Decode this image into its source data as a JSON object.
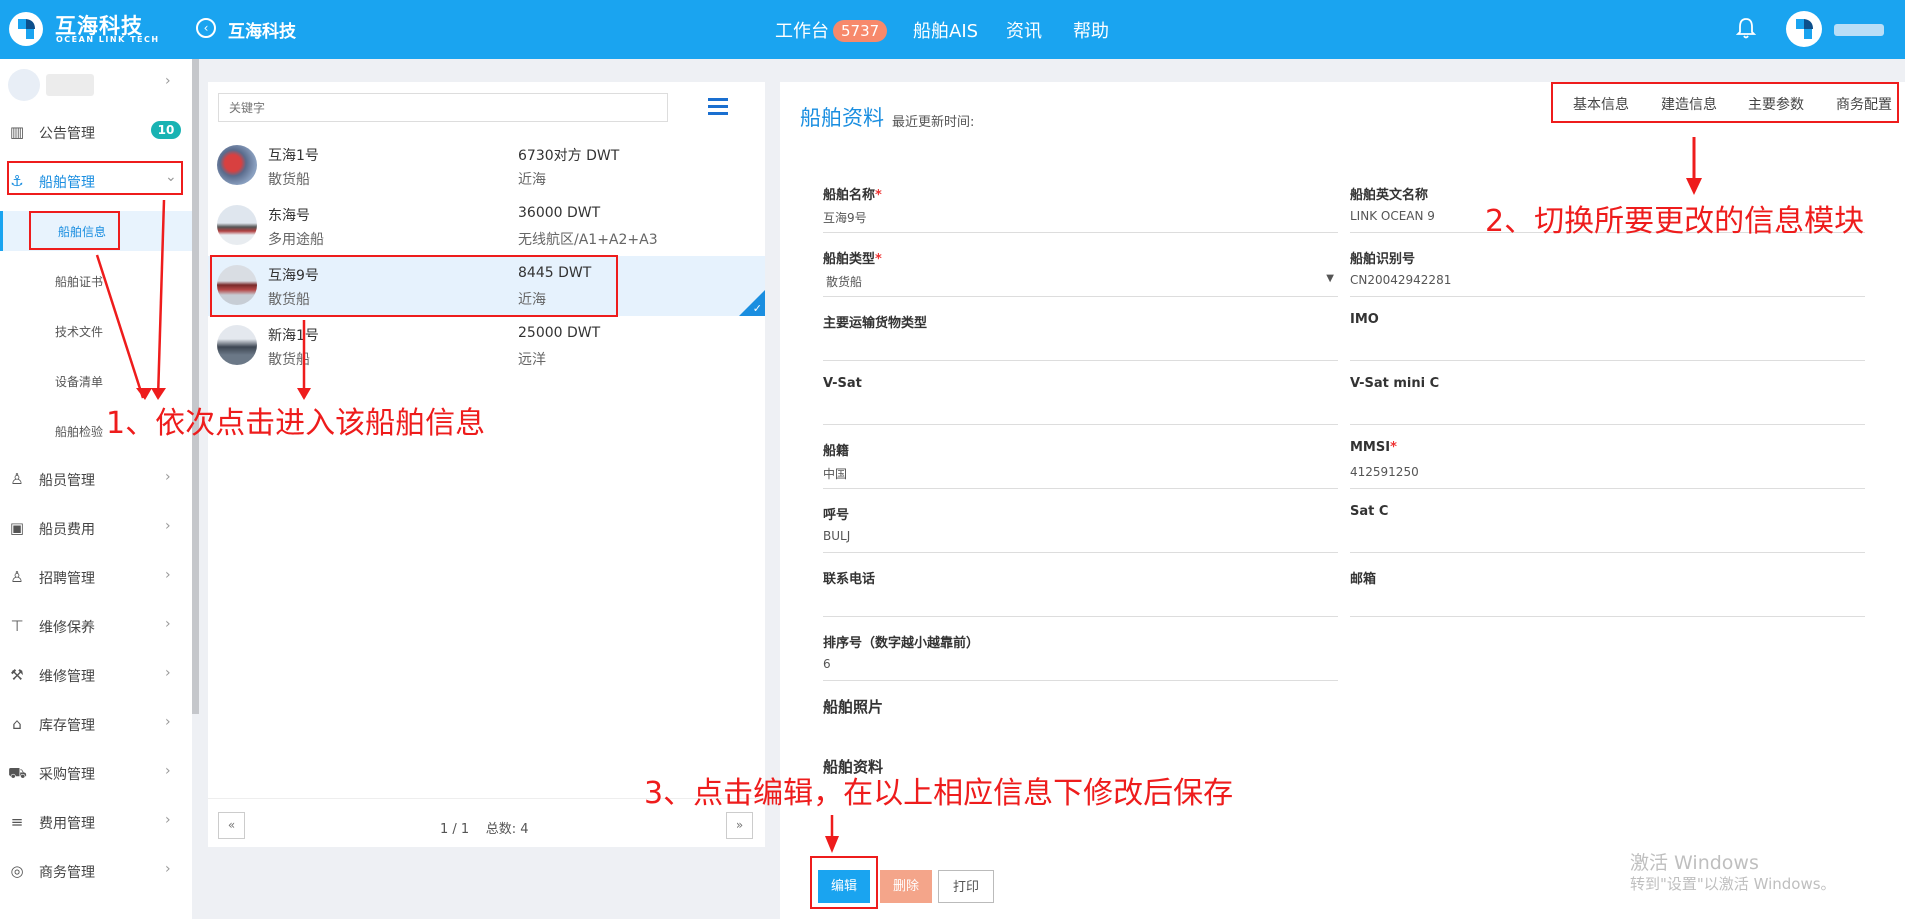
{
  "header": {
    "brand_cn": "互海科技",
    "brand_en": "OCEAN LINK TECH",
    "page_title": "互海科技",
    "nav": [
      {
        "label": "工作台",
        "badge": "5737"
      },
      {
        "label": "船舶AIS"
      },
      {
        "label": "资讯"
      },
      {
        "label": "帮助"
      }
    ]
  },
  "sidebar": {
    "notice": {
      "label": "公告管理",
      "badge": "10"
    },
    "ship_mgmt": {
      "label": "船舶管理"
    },
    "ship_subitems": [
      "船舶信息",
      "船舶证书",
      "技术文件",
      "设备清单",
      "船舶检验"
    ],
    "items": [
      "船员管理",
      "船员费用",
      "招聘管理",
      "维修保养",
      "维修管理",
      "库存管理",
      "采购管理",
      "费用管理",
      "商务管理"
    ]
  },
  "ship_list": {
    "search_placeholder": "关键字",
    "ships": [
      {
        "name": "互海1号",
        "type": "散货船",
        "dwt": "6730对方 DWT",
        "area": "近海"
      },
      {
        "name": "东海号",
        "type": "多用途船",
        "dwt": "36000 DWT",
        "area": "无线航区/A1+A2+A3"
      },
      {
        "name": "互海9号",
        "type": "散货船",
        "dwt": "8445 DWT",
        "area": "近海"
      },
      {
        "name": "新海1号",
        "type": "散货船",
        "dwt": "25000 DWT",
        "area": "远洋"
      }
    ],
    "pager": {
      "prev": "«",
      "next": "»",
      "page": "1 / 1",
      "total": "总数: 4"
    }
  },
  "detail": {
    "title": "船舶资料",
    "subtitle": "最近更新时间:",
    "tabs": [
      "基本信息",
      "建造信息",
      "主要参数",
      "商务配置"
    ],
    "fields": {
      "name_label": "船舶名称",
      "name_value": "互海9号",
      "en_name_label": "船舶英文名称",
      "en_name_value": "LINK OCEAN 9",
      "type_label": "船舶类型",
      "type_value": "散货船",
      "id_label": "船舶识别号",
      "id_value": "CN20042942281",
      "cargo_label": "主要运输货物类型",
      "imo_label": "IMO",
      "vsat_label": "V-Sat",
      "vsat_mini_label": "V-Sat mini C",
      "flag_label": "船籍",
      "flag_value": "中国",
      "mmsi_label": "MMSI",
      "mmsi_value": "412591250",
      "callsign_label": "呼号",
      "callsign_value": "BULJ",
      "satc_label": "Sat C",
      "phone_label": "联系电话",
      "email_label": "邮箱",
      "order_label": "排序号（数字越小越靠前）",
      "order_value": "6"
    },
    "photo_section": "船舶照片",
    "docs_section": "船舶资料",
    "buttons": {
      "edit": "编辑",
      "delete": "删除",
      "print": "打印"
    }
  },
  "watermark": {
    "line1": "激活 Windows",
    "line2": "转到\"设置\"以激活 Windows。"
  },
  "annotations": {
    "step1": "1、依次点击进入该船舶信息",
    "step2": "2、切换所要更改的信息模块",
    "step3": "3、点击编辑，在以上相应信息下修改后保存"
  },
  "colors": {
    "primary": "#1aa4f0",
    "annotation": "#ee1c1c",
    "delete": "#f4a58a"
  }
}
